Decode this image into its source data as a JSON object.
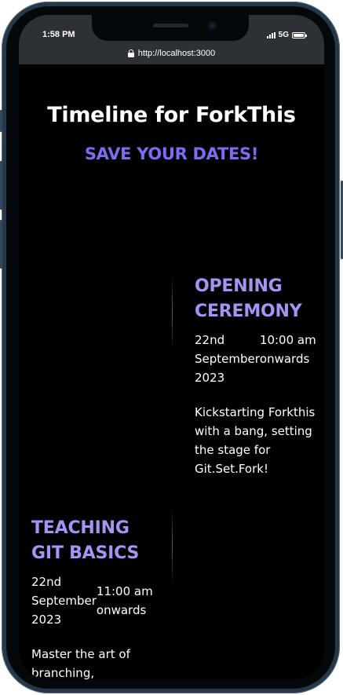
{
  "status_bar": {
    "time": "1:58 PM",
    "network": "5G"
  },
  "browser": {
    "url": "http://localhost:3000"
  },
  "page": {
    "title": "Timeline for ForkThis",
    "subtitle": "SAVE YOUR DATES!",
    "accent_color": "#7c6cf2",
    "events": [
      {
        "title": "OPENING CEREMONY",
        "date": "22nd September 2023",
        "time": "10:00 am onwards",
        "description": "Kickstarting Forkthis with a bang, setting the stage for Git.Set.Fork!"
      },
      {
        "title": "TEACHING GIT BASICS",
        "date": "22nd September 2023",
        "time": "11:00 am onwards",
        "description": "Master the art of branching,"
      }
    ]
  },
  "icons": [
    "lock-icon",
    "signal-icon",
    "battery-icon",
    "camera-icon"
  ]
}
